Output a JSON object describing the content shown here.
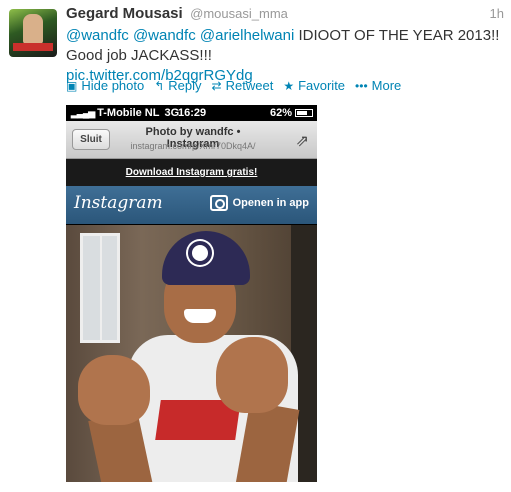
{
  "tweet": {
    "author_name": "Gegard Mousasi",
    "author_handle": "@mousasi_mma",
    "time": "1h",
    "mentions": [
      "@wandfc",
      "@wandfc",
      "@arielhelwani"
    ],
    "text": "IDIOOT OF THE YEAR 2013!!  Good job JACKASS!!!",
    "link": "pic.twitter.com/b2qgrRGYdg"
  },
  "actions": {
    "hide_photo": "Hide photo",
    "reply": "Reply",
    "retweet": "Retweet",
    "favorite": "Favorite",
    "more": "More"
  },
  "photo": {
    "status_bar": {
      "carrier": "T-Mobile NL",
      "network": "3G",
      "clock": "16:29",
      "battery": "62%"
    },
    "nav": {
      "close_label": "Sluit",
      "title": "Photo by wandfc • Instagram",
      "url": "instagram.com/p/Xmr70Dkq4A/"
    },
    "download_banner": "Download Instagram gratis!",
    "app_bar": {
      "logo": "Instagram",
      "open_label": "Openen in app"
    }
  },
  "colors": {
    "link": "#0084b4",
    "instagram_bar": "#3a6890"
  },
  "icons": [
    "photo-icon",
    "reply-icon",
    "retweet-icon",
    "favorite-star-icon",
    "more-dots-icon",
    "share-icon",
    "camera-icon"
  ]
}
